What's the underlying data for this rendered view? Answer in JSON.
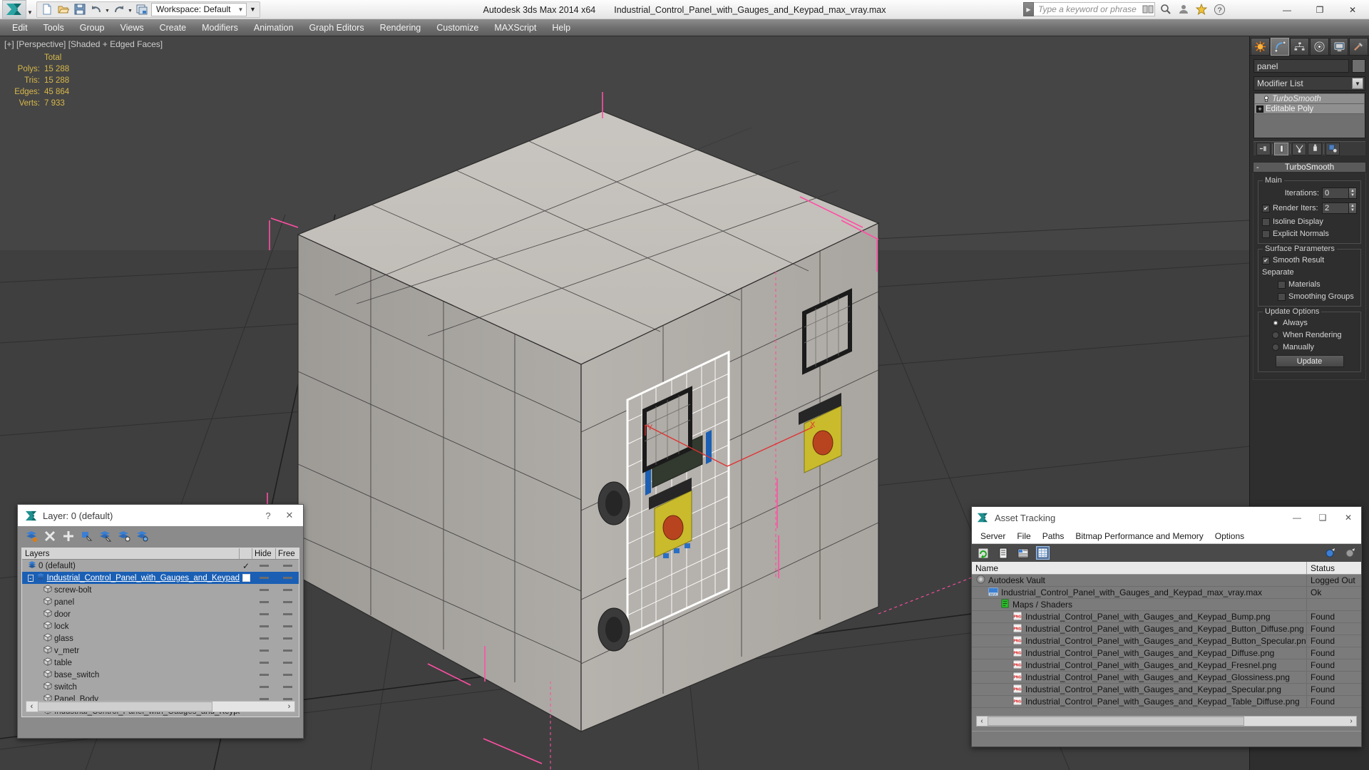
{
  "titlebar": {
    "app_title": "Autodesk 3ds Max  2014 x64",
    "file_title": "Industrial_Control_Panel_with_Gauges_and_Keypad_max_vray.max",
    "workspace_label": "Workspace: Default",
    "search_placeholder": "Type a keyword or phrase",
    "quick_access": [
      {
        "name": "new-file-icon",
        "label": "New"
      },
      {
        "name": "open-file-icon",
        "label": "Open"
      },
      {
        "name": "save-file-icon",
        "label": "Save"
      },
      {
        "name": "undo-icon",
        "label": "Undo"
      },
      {
        "name": "redo-icon",
        "label": "Redo"
      },
      {
        "name": "project-folder-icon",
        "label": "Set Project Folder"
      }
    ],
    "window_buttons": [
      {
        "name": "minimize-button",
        "glyph": "—"
      },
      {
        "name": "maximize-button",
        "glyph": "❐"
      },
      {
        "name": "close-button",
        "glyph": "✕"
      }
    ]
  },
  "menubar": {
    "items": [
      "Edit",
      "Tools",
      "Group",
      "Views",
      "Create",
      "Modifiers",
      "Animation",
      "Graph Editors",
      "Rendering",
      "Customize",
      "MAXScript",
      "Help"
    ]
  },
  "viewport": {
    "label": "[+] [Perspective] [Shaded + Edged Faces]",
    "stats": {
      "header": "Total",
      "rows": [
        {
          "label": "Polys:",
          "value": "15 288"
        },
        {
          "label": "Tris:",
          "value": "15 288"
        },
        {
          "label": "Edges:",
          "value": "45 864"
        },
        {
          "label": "Verts:",
          "value": "7 933"
        }
      ]
    }
  },
  "command_panel": {
    "tabs": [
      {
        "name": "tab-create",
        "label": "Create"
      },
      {
        "name": "tab-modify",
        "label": "Modify",
        "active": true
      },
      {
        "name": "tab-hierarchy",
        "label": "Hierarchy"
      },
      {
        "name": "tab-motion",
        "label": "Motion"
      },
      {
        "name": "tab-display",
        "label": "Display"
      },
      {
        "name": "tab-utilities",
        "label": "Utilities"
      }
    ],
    "object_name": "panel",
    "modifier_list_label": "Modifier List",
    "stack": [
      {
        "label": "TurboSmooth",
        "type": "modifier",
        "selected": true
      },
      {
        "label": "Editable Poly",
        "type": "base"
      }
    ],
    "turbosmooth": {
      "title": "TurboSmooth",
      "collapse_glyph": "-",
      "main_group": "Main",
      "iterations_label": "Iterations:",
      "iterations_value": "0",
      "render_iters_label": "Render Iters:",
      "render_iters_value": "2",
      "render_iters_checked": true,
      "isoline_label": "Isoline Display",
      "isoline_checked": false,
      "explicit_normals_label": "Explicit Normals",
      "explicit_normals_checked": false,
      "surface_group": "Surface Parameters",
      "smooth_result_label": "Smooth Result",
      "smooth_result_checked": true,
      "separate_label": "Separate",
      "materials_label": "Materials",
      "materials_checked": false,
      "smoothing_groups_label": "Smoothing Groups",
      "smoothing_groups_checked": false,
      "update_group": "Update Options",
      "always_label": "Always",
      "when_rendering_label": "When Rendering",
      "manually_label": "Manually",
      "selected_update": "Always",
      "update_button": "Update"
    }
  },
  "layer_dialog": {
    "title": "Layer: 0 (default)",
    "help_glyph": "?",
    "close_glyph": "✕",
    "toolbar": [
      {
        "name": "create-new-layer-icon"
      },
      {
        "name": "delete-layer-icon"
      },
      {
        "name": "add-selection-to-layer-icon"
      },
      {
        "name": "select-objects-in-layer-icon"
      },
      {
        "name": "select-highlighted-objects-icon"
      },
      {
        "name": "highlight-selected-objects-icon"
      },
      {
        "name": "layer-properties-icon"
      }
    ],
    "columns": [
      "Layers",
      "",
      "Hide",
      "Free"
    ],
    "rows": [
      {
        "name": "0 (default)",
        "indent": 0,
        "type": "layer",
        "check": "✓",
        "selected": false,
        "expander": null
      },
      {
        "name": "Industrial_Control_Panel_with_Gauges_and_Keypad",
        "indent": 0,
        "type": "layer",
        "check": "box",
        "selected": true,
        "expander": "-"
      },
      {
        "name": "screw-bolt",
        "indent": 1,
        "type": "object",
        "selected": false
      },
      {
        "name": "panel",
        "indent": 1,
        "type": "object",
        "selected": false
      },
      {
        "name": "door",
        "indent": 1,
        "type": "object",
        "selected": false
      },
      {
        "name": "lock",
        "indent": 1,
        "type": "object",
        "selected": false
      },
      {
        "name": "glass",
        "indent": 1,
        "type": "object",
        "selected": false
      },
      {
        "name": "v_metr",
        "indent": 1,
        "type": "object",
        "selected": false
      },
      {
        "name": "table",
        "indent": 1,
        "type": "object",
        "selected": false
      },
      {
        "name": "base_switch",
        "indent": 1,
        "type": "object",
        "selected": false
      },
      {
        "name": "switch",
        "indent": 1,
        "type": "object",
        "selected": false
      },
      {
        "name": "Panel_Body",
        "indent": 1,
        "type": "object",
        "selected": false
      },
      {
        "name": "Industrial_Control_Panel_with_Gauges_and_Keypad",
        "indent": 1,
        "type": "object",
        "selected": false
      }
    ],
    "scroll_left_glyph": "‹",
    "scroll_right_glyph": "›"
  },
  "asset_tracking": {
    "title": "Asset Tracking",
    "window_buttons": [
      {
        "name": "minimize-button",
        "glyph": "—"
      },
      {
        "name": "maximize-button",
        "glyph": "❑"
      },
      {
        "name": "close-button",
        "glyph": "✕"
      }
    ],
    "menu": [
      "Server",
      "File",
      "Paths",
      "Bitmap Performance and Memory",
      "Options"
    ],
    "columns": [
      "Name",
      "Status"
    ],
    "rows": [
      {
        "name": "Autodesk Vault",
        "status": "Logged Out",
        "indent": 0,
        "icon": "vault-icon"
      },
      {
        "name": "Industrial_Control_Panel_with_Gauges_and_Keypad_max_vray.max",
        "status": "Ok",
        "indent": 1,
        "icon": "max-file-icon"
      },
      {
        "name": "Maps / Shaders",
        "status": "",
        "indent": 2,
        "icon": "maps-shaders-icon"
      },
      {
        "name": "Industrial_Control_Panel_with_Gauges_and_Keypad_Bump.png",
        "status": "Found",
        "indent": 3,
        "icon": "png-icon"
      },
      {
        "name": "Industrial_Control_Panel_with_Gauges_and_Keypad_Button_Diffuse.png",
        "status": "Found",
        "indent": 3,
        "icon": "png-icon"
      },
      {
        "name": "Industrial_Control_Panel_with_Gauges_and_Keypad_Button_Specular.png",
        "status": "Found",
        "indent": 3,
        "icon": "png-icon"
      },
      {
        "name": "Industrial_Control_Panel_with_Gauges_and_Keypad_Diffuse.png",
        "status": "Found",
        "indent": 3,
        "icon": "png-icon"
      },
      {
        "name": "Industrial_Control_Panel_with_Gauges_and_Keypad_Fresnel.png",
        "status": "Found",
        "indent": 3,
        "icon": "png-icon"
      },
      {
        "name": "Industrial_Control_Panel_with_Gauges_and_Keypad_Glossiness.png",
        "status": "Found",
        "indent": 3,
        "icon": "png-icon"
      },
      {
        "name": "Industrial_Control_Panel_with_Gauges_and_Keypad_Specular.png",
        "status": "Found",
        "indent": 3,
        "icon": "png-icon"
      },
      {
        "name": "Industrial_Control_Panel_with_Gauges_and_Keypad_Table_Diffuse.png",
        "status": "Found",
        "indent": 3,
        "icon": "png-icon"
      }
    ],
    "scroll_left_glyph": "‹",
    "scroll_right_glyph": "›"
  },
  "colors": {
    "accent_selection": "#1a5fb4",
    "stats_text": "#d8b84a",
    "viewport_bg": "#454545",
    "gizmo_pink": "#ff79c6",
    "panel_bg": "#2e2e2e"
  }
}
